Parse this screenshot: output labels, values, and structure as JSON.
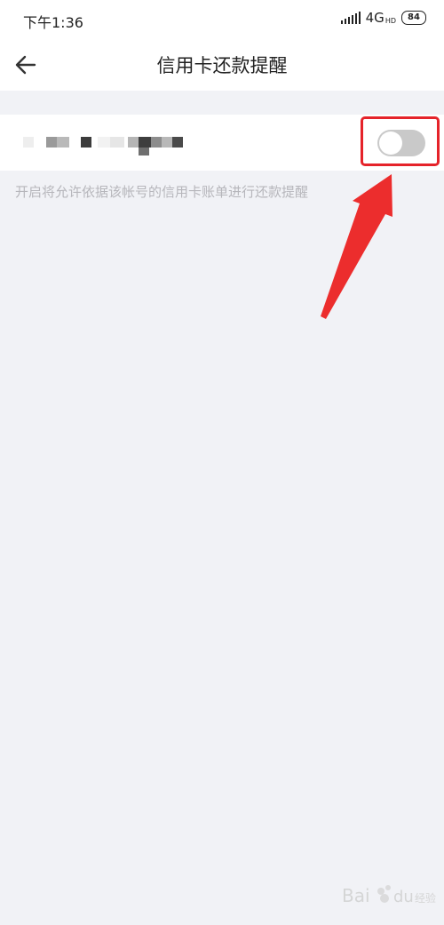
{
  "status_bar": {
    "time": "下午1:36",
    "network": "4G",
    "network_sub": "HD",
    "battery": "84"
  },
  "nav": {
    "title": "信用卡还款提醒",
    "back_icon": "arrow-left-icon"
  },
  "card": {
    "account_name": "",
    "toggle_state": "off"
  },
  "hint": "开启将允许依据该帐号的信用卡账单进行还款提醒",
  "annotation": {
    "color": "#e5232a"
  },
  "watermark": {
    "text": "Bai du 经验"
  },
  "colors": {
    "background": "#f1f2f6",
    "surface": "#ffffff",
    "toggle_off": "#c9c9c9",
    "hint": "#b6b6bb"
  }
}
